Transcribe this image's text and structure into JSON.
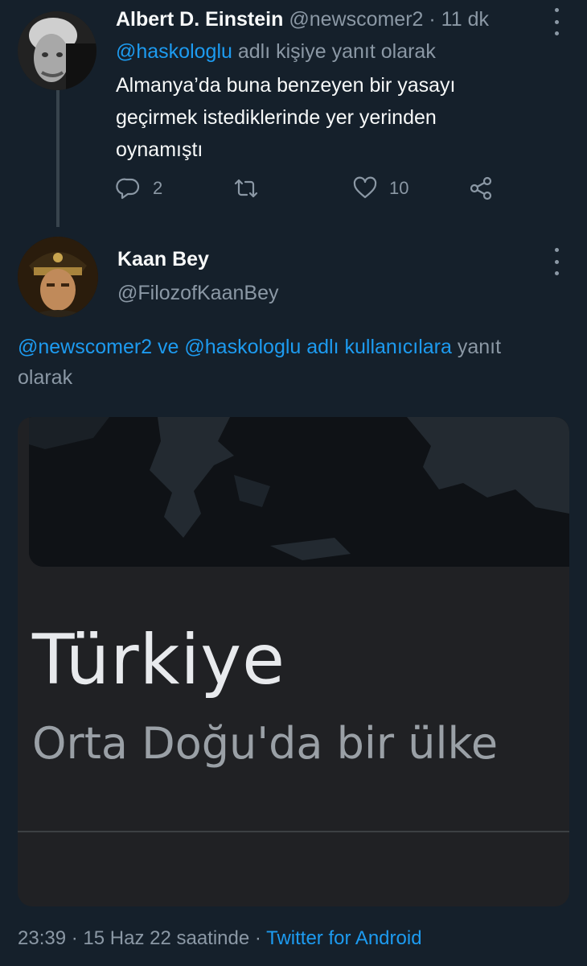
{
  "tweet1": {
    "author_name": "Albert D. Einstein",
    "handle": "@newscomer2",
    "separator": "·",
    "time": "11 dk",
    "reply_to_handle": "@haskologlu",
    "reply_to_suffix": "adlı kişiye yanıt olarak",
    "text_lines": [
      "Almanya’da buna benzeyen bir yasayı",
      "geçirmek istediklerinde yer yerinden",
      "oynamıştı"
    ],
    "actions": {
      "reply_count": "2",
      "retweet_count": "",
      "like_count": "10"
    },
    "icons": [
      "avatar",
      "more-icon",
      "reply-icon",
      "retweet-icon",
      "like-icon",
      "share-icon"
    ]
  },
  "tweet2": {
    "author_name": "Kaan Bey",
    "handle": "@FilozofKaanBey",
    "reply_prefix_links": "@newscomer2 ve @haskologlu adlı kullanıcılara",
    "reply_suffix_line1": "yanıt",
    "reply_suffix_line2": "olarak",
    "media": {
      "title": "Türkiye",
      "subtitle": "Orta Doğu'da bir ülke"
    },
    "footer": {
      "time": "23:39",
      "separator1": "·",
      "date": "15 Haz 22 saatinde",
      "separator2": "·",
      "source": "Twitter for Android"
    }
  },
  "colors": {
    "background": "#15202b",
    "text": "#f7f9f9",
    "muted": "#8b98a5",
    "link": "#1d9bf0"
  }
}
